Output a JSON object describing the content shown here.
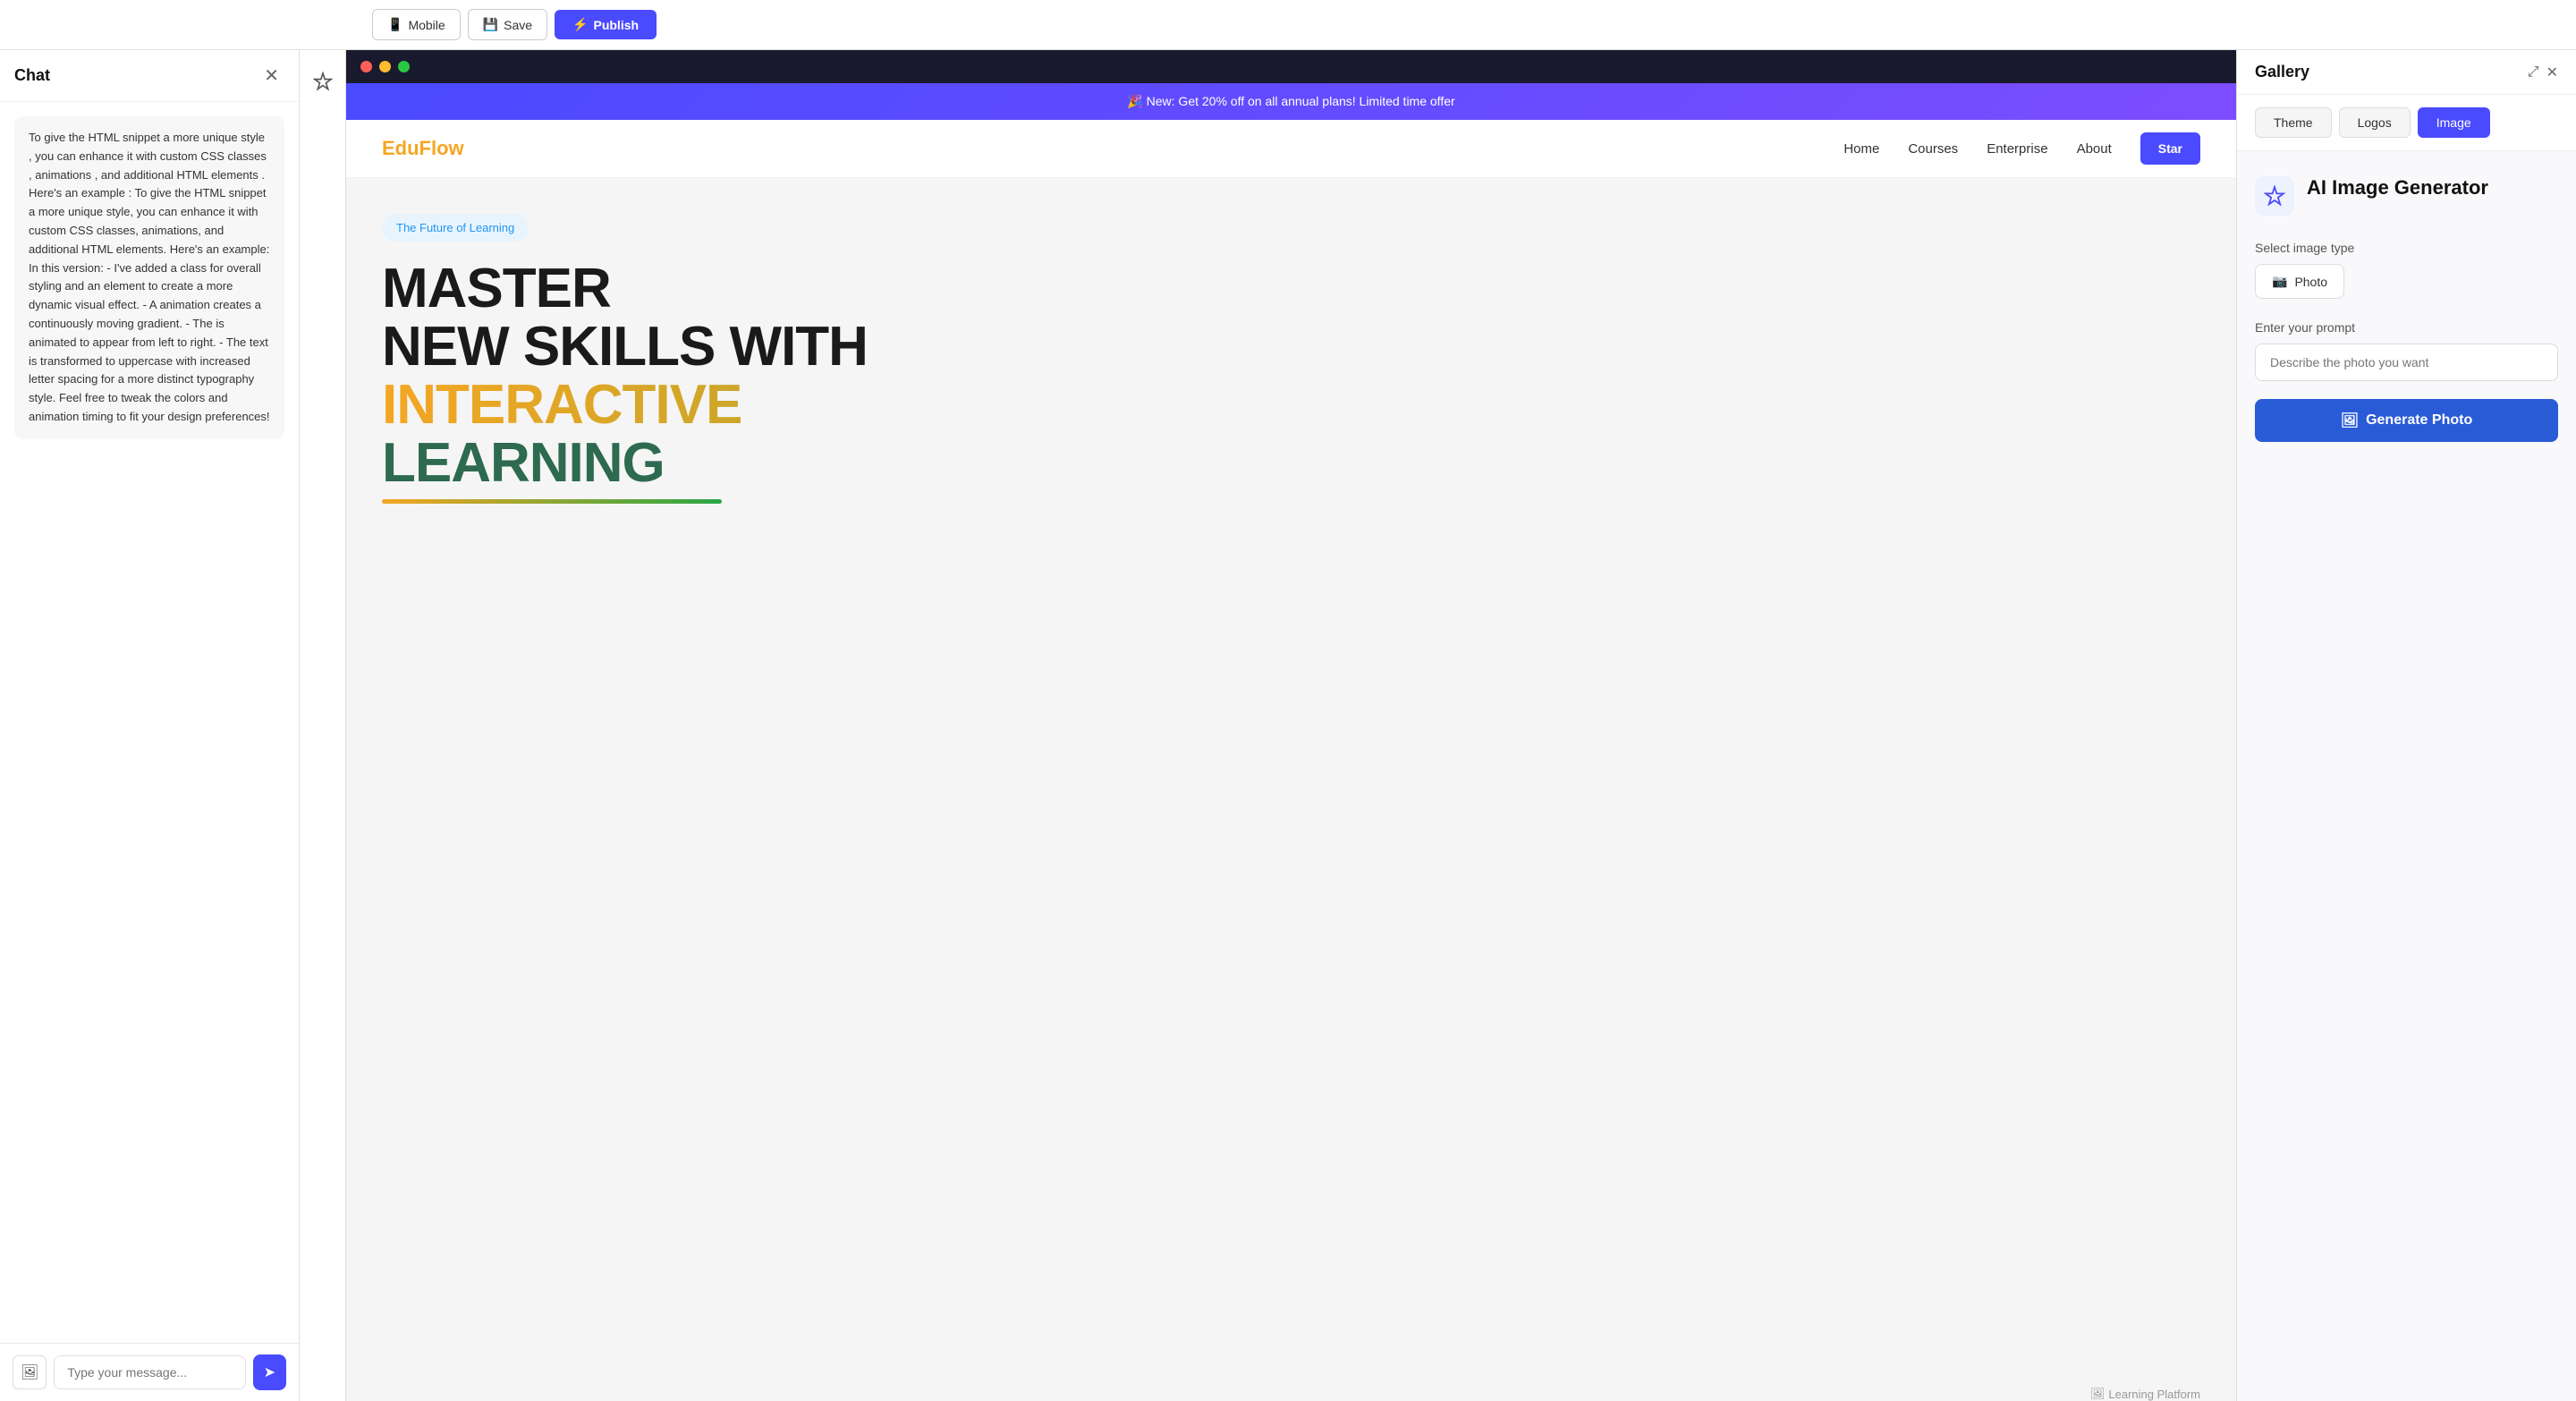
{
  "toolbar": {
    "mobile_label": "Mobile",
    "save_label": "Save",
    "publish_label": "Publish"
  },
  "chat": {
    "title": "Chat",
    "message": "To give the HTML snippet a more unique style , you can enhance it with custom CSS classes , animations , and additional HTML elements . Here's an example : To give the HTML snippet a more unique style, you can enhance it with custom CSS classes, animations, and additional HTML elements. Here's an example: In this version: - I've added a class for overall styling and an element to create a more dynamic visual effect. - A animation creates a continuously moving gradient. - The is animated to appear from left to right. - The text is transformed to uppercase with increased letter spacing for a more distinct typography style. Feel free to tweak the colors and animation timing to fit your design preferences!",
    "input_placeholder": "Type your message...",
    "close_icon": "✕"
  },
  "preview": {
    "banner_text": "🎉 New: Get 20% off on all annual plans! Limited time offer",
    "logo": "EduFlow",
    "nav_links": [
      "Home",
      "Courses",
      "Enterprise",
      "About"
    ],
    "nav_btn": "Star",
    "tag": "The Future of Learning",
    "headline_line1": "MASTER",
    "headline_line2": "NEW SKILLS WITH",
    "headline_colored": "INTERACTIVE",
    "headline_green": "LEARNING",
    "image_alt": "Learning Platform"
  },
  "gallery": {
    "title": "Gallery",
    "tabs": [
      "Theme",
      "Logos",
      "Image"
    ],
    "active_tab": "Image",
    "ai_title": "AI Image Generator",
    "select_type_label": "Select image type",
    "photo_btn_label": "Photo",
    "prompt_label": "Enter your prompt",
    "prompt_placeholder": "Describe the photo you want",
    "generate_btn_label": "Generate Photo"
  }
}
